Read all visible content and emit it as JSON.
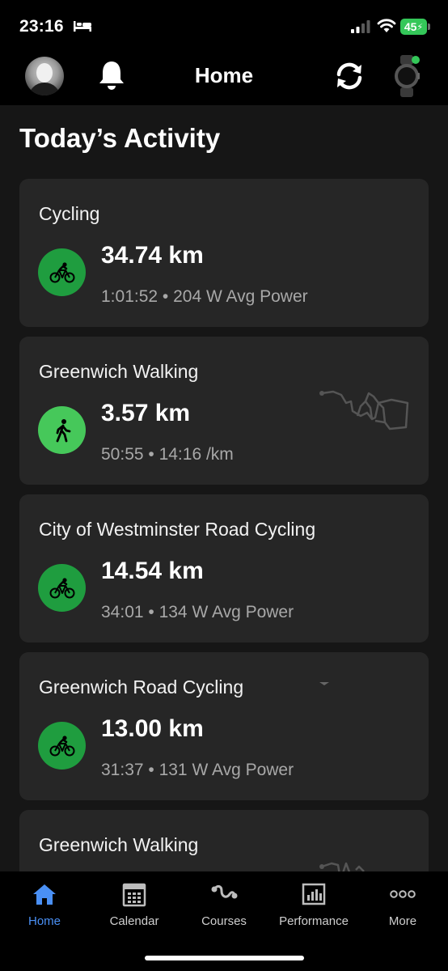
{
  "status_bar": {
    "time": "23:16",
    "battery_level": "45",
    "icons": [
      "bed-icon",
      "signal-icon",
      "wifi-icon",
      "battery-icon"
    ]
  },
  "header": {
    "title": "Home",
    "icons": [
      "avatar",
      "bell-icon",
      "sync-icon",
      "watch-icon"
    ],
    "watch_status_color": "#34c759"
  },
  "section": {
    "title": "Today’s Activity"
  },
  "activities": [
    {
      "title": "Cycling",
      "distance": "34.74 km",
      "stats": "1:01:52 • 204 W Avg Power",
      "icon": "cycling-icon",
      "badge_color": "#1f9d3f"
    },
    {
      "title": "Greenwich Walking",
      "distance": "3.57 km",
      "stats": "50:55 • 14:16 /km",
      "icon": "walking-icon",
      "badge_color": "#46c85a"
    },
    {
      "title": "City of Westminster Road Cycling",
      "distance": "14.54 km",
      "stats": "34:01 • 134 W Avg Power",
      "icon": "cycling-icon",
      "badge_color": "#1f9d3f"
    },
    {
      "title": "Greenwich Road Cycling",
      "distance": "13.00 km",
      "stats": "31:37 • 131 W Avg Power",
      "icon": "cycling-icon",
      "badge_color": "#1f9d3f"
    },
    {
      "title": "Greenwich Walking",
      "icon": "walking-icon"
    }
  ],
  "tabs": [
    {
      "label": "Home",
      "icon": "home-icon",
      "active": true
    },
    {
      "label": "Calendar",
      "icon": "calendar-icon",
      "active": false
    },
    {
      "label": "Courses",
      "icon": "courses-icon",
      "active": false
    },
    {
      "label": "Performance",
      "icon": "performance-icon",
      "active": false
    },
    {
      "label": "More",
      "icon": "more-icon",
      "active": false
    }
  ],
  "colors": {
    "accent": "#4a90f5",
    "card_bg": "#262626",
    "background": "#161616"
  }
}
